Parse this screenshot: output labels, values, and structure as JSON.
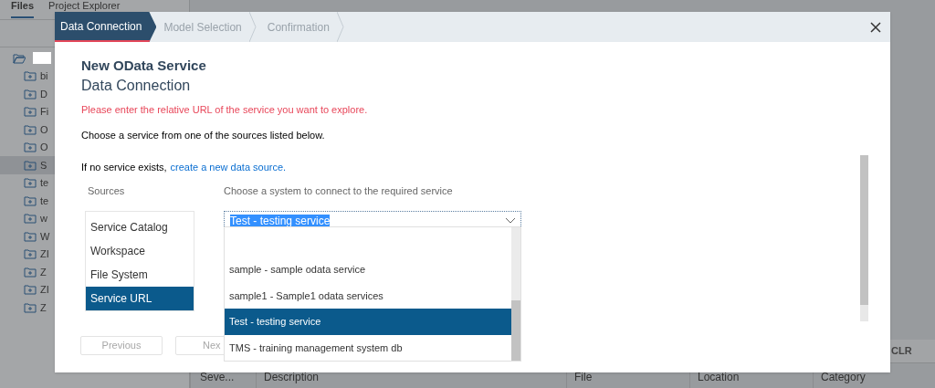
{
  "background": {
    "tabs": [
      {
        "label": "Files",
        "selected": true
      },
      {
        "label": "Project Explorer",
        "selected": false
      }
    ],
    "tree": {
      "expanded": true,
      "children": [
        {
          "label": "bi",
          "selected": false
        },
        {
          "label": "D",
          "selected": false
        },
        {
          "label": "Fi",
          "selected": false
        },
        {
          "label": "O",
          "selected": false
        },
        {
          "label": "O",
          "selected": false
        },
        {
          "label": "S",
          "selected": true
        },
        {
          "label": "te",
          "selected": false
        },
        {
          "label": "te",
          "selected": false
        },
        {
          "label": "w",
          "selected": false
        },
        {
          "label": "W",
          "selected": false
        },
        {
          "label": "ZI",
          "selected": false
        },
        {
          "label": "Z",
          "selected": false
        },
        {
          "label": "ZI",
          "selected": false
        },
        {
          "label": "Z",
          "selected": false
        }
      ]
    },
    "table": {
      "button": "CLR",
      "columns": [
        "Seve...",
        "Description",
        "File",
        "Location",
        "Category"
      ]
    }
  },
  "dialog": {
    "steps": [
      {
        "label": "Data Connection",
        "selected": true
      },
      {
        "label": "Model Selection",
        "selected": false
      },
      {
        "label": "Confirmation",
        "selected": false
      }
    ],
    "title": "New OData Service",
    "subtitle": "Data Connection",
    "error": "Please enter the relative URL of the service you want to explore.",
    "intro": "Choose a service from one of the sources listed below.",
    "hint": {
      "text": "If no service exists,",
      "link": "create a new data source."
    },
    "sources": {
      "label": "Sources",
      "items": [
        {
          "label": "Service Catalog",
          "selected": false
        },
        {
          "label": "Workspace",
          "selected": false
        },
        {
          "label": "File System",
          "selected": false
        },
        {
          "label": "Service URL",
          "selected": true
        }
      ]
    },
    "system": {
      "label": "Choose a system to connect to the required service",
      "value": "Test - testing service",
      "expanded": true,
      "options": [
        {
          "label": "sample - sample odata service",
          "selected": false
        },
        {
          "label": "sample1 - Sample1 odata services",
          "selected": false
        },
        {
          "label": "Test - testing service",
          "selected": true
        },
        {
          "label": "TMS - training management system db",
          "selected": false
        }
      ]
    },
    "buttons": [
      {
        "label": "Previous",
        "disabled": true
      },
      {
        "label": "Nex",
        "disabled": true
      }
    ]
  }
}
